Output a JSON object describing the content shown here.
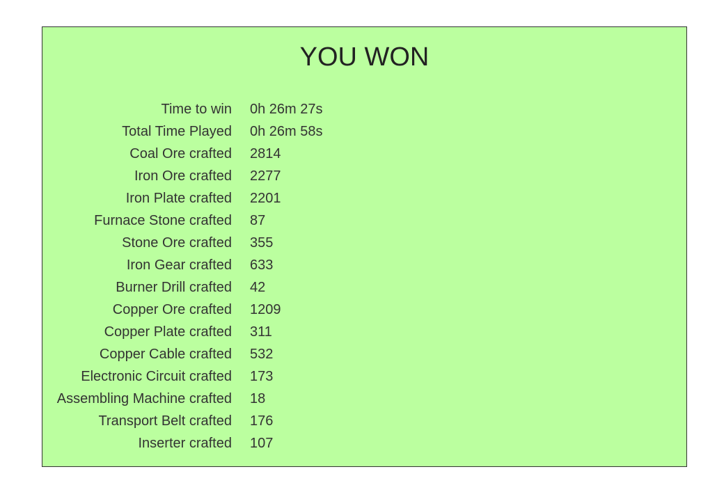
{
  "title": "YOU WON",
  "stats": [
    {
      "label": "Time to win",
      "value": "0h 26m 27s"
    },
    {
      "label": "Total Time Played",
      "value": "0h 26m 58s"
    },
    {
      "label": "Coal Ore crafted",
      "value": "2814"
    },
    {
      "label": "Iron Ore crafted",
      "value": "2277"
    },
    {
      "label": "Iron Plate crafted",
      "value": "2201"
    },
    {
      "label": "Furnace Stone crafted",
      "value": "87"
    },
    {
      "label": "Stone Ore crafted",
      "value": "355"
    },
    {
      "label": "Iron Gear crafted",
      "value": "633"
    },
    {
      "label": "Burner Drill crafted",
      "value": "42"
    },
    {
      "label": "Copper Ore crafted",
      "value": "1209"
    },
    {
      "label": "Copper Plate crafted",
      "value": "311"
    },
    {
      "label": "Copper Cable crafted",
      "value": "532"
    },
    {
      "label": "Electronic Circuit crafted",
      "value": "173"
    },
    {
      "label": "Assembling Machine crafted",
      "value": "18"
    },
    {
      "label": "Transport Belt crafted",
      "value": "176"
    },
    {
      "label": "Inserter crafted",
      "value": "107"
    }
  ],
  "colors": {
    "panel_background": "#bbff9f",
    "panel_border": "#333333",
    "text": "#333333"
  }
}
